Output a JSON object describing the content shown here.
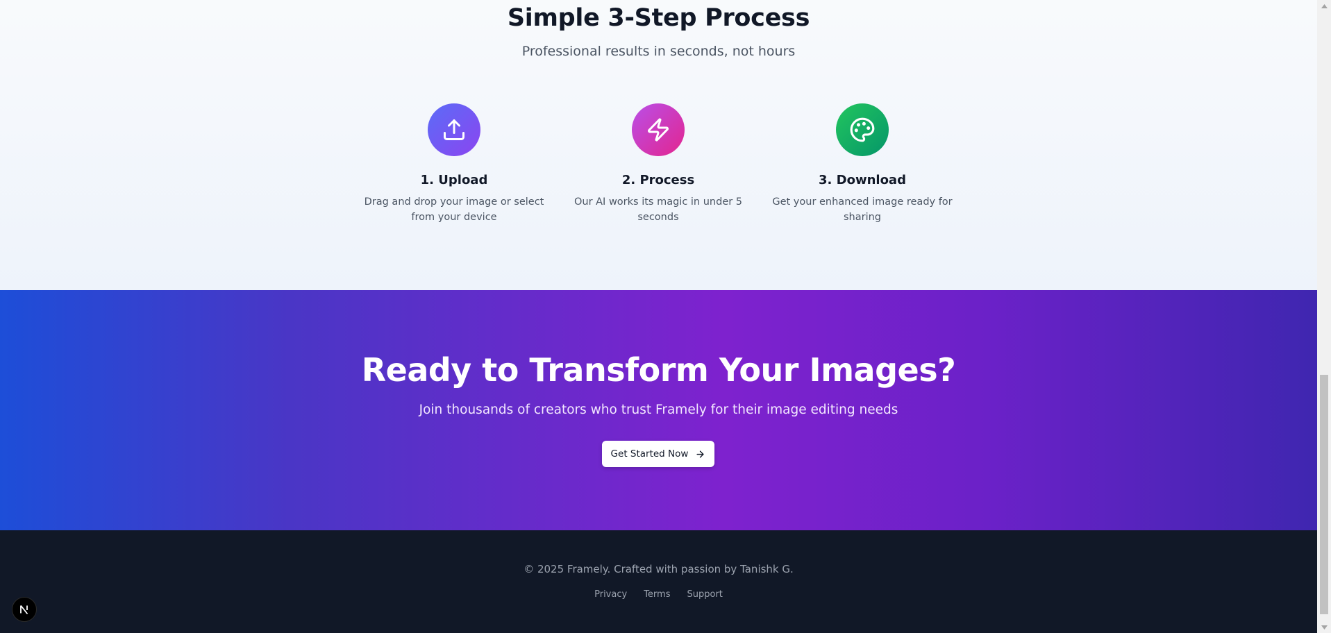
{
  "steps_section": {
    "title": "Simple 3-Step Process",
    "subtitle": "Professional results in seconds, not hours",
    "steps": [
      {
        "title": "1. Upload",
        "description": "Drag and drop your image or select from your device",
        "icon": "upload-icon",
        "gradient": [
          "#5b6cf7",
          "#8b45f0"
        ]
      },
      {
        "title": "2. Process",
        "description": "Our AI works its magic in under 5 seconds",
        "icon": "zap-icon",
        "gradient": [
          "#b94fe8",
          "#e3258f"
        ]
      },
      {
        "title": "3. Download",
        "description": "Get your enhanced image ready for sharing",
        "icon": "palette-icon",
        "gradient": [
          "#22c55e",
          "#059669"
        ]
      }
    ]
  },
  "cta_section": {
    "title": "Ready to Transform Your Images?",
    "subtitle": "Join thousands of creators who trust Framely for their image editing needs",
    "button_label": "Get Started Now",
    "button_icon": "arrow-right-icon"
  },
  "footer": {
    "copyright": "© 2025 Framely. Crafted with passion by Tanishk G.",
    "links": [
      "Privacy",
      "Terms",
      "Support"
    ]
  },
  "colors": {
    "footer_bg": "#111827",
    "cta_gradient": [
      "#1d4ed8",
      "#7e22ce",
      "#3f26b0"
    ]
  },
  "badge": {
    "label": "N"
  }
}
